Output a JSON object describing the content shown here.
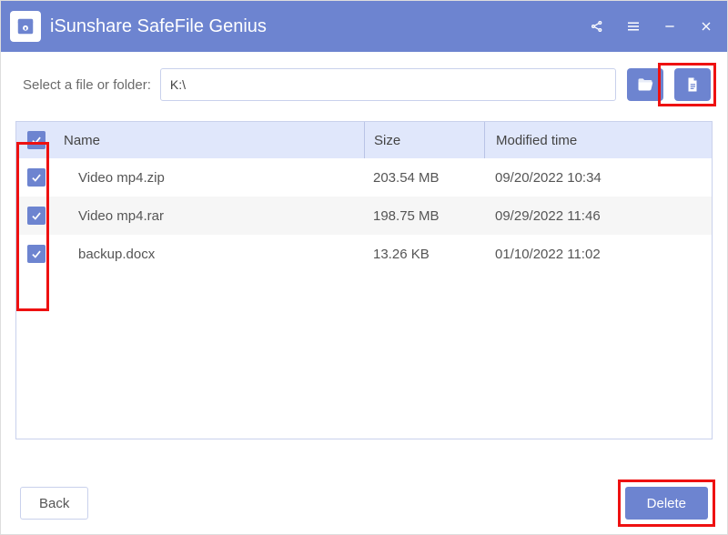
{
  "header": {
    "title": "iSunshare SafeFile Genius"
  },
  "picker": {
    "label": "Select a file or folder:",
    "path": "K:\\"
  },
  "table": {
    "columns": {
      "name": "Name",
      "size": "Size",
      "mtime": "Modified time"
    },
    "rows": [
      {
        "checked": true,
        "name": "Video mp4.zip",
        "size": "203.54 MB",
        "mtime": "09/20/2022 10:34"
      },
      {
        "checked": true,
        "name": "Video mp4.rar",
        "size": "198.75 MB",
        "mtime": "09/29/2022 11:46"
      },
      {
        "checked": true,
        "name": "backup.docx",
        "size": "13.26 KB",
        "mtime": "01/10/2022 11:02"
      }
    ],
    "headerChecked": true
  },
  "footer": {
    "back": "Back",
    "delete": "Delete"
  }
}
